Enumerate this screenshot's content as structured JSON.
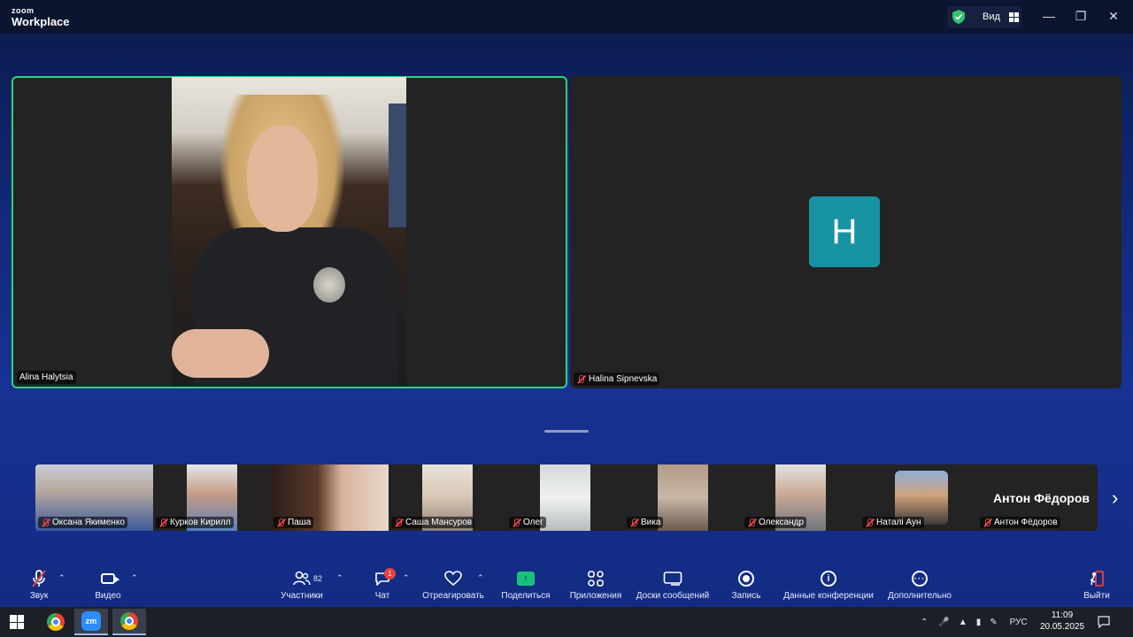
{
  "app": {
    "brand_top": "zoom",
    "brand_bottom": "Workplace",
    "view_label": "Вид",
    "window_controls": [
      "minimize-icon",
      "restore-icon",
      "close-icon"
    ]
  },
  "main_tiles": [
    {
      "name": "Alina Halytsia",
      "muted": false,
      "active": true
    },
    {
      "name": "Halina Sipnevska",
      "muted": true,
      "avatar_letter": "H",
      "avatar_color": "#1793a4"
    }
  ],
  "thumbnails": [
    {
      "name": "Оксана Якименко"
    },
    {
      "name": "Курков Кирилл"
    },
    {
      "name": "Паша"
    },
    {
      "name": "Саша Мансуров"
    },
    {
      "name": "Олег"
    },
    {
      "name": "Вика"
    },
    {
      "name": "Олександр"
    },
    {
      "name": "Наталі Аун"
    },
    {
      "name": "Антон Фёдоров",
      "big_label": "Антон Фёдоров"
    }
  ],
  "toolbar": {
    "audio": "Звук",
    "video": "Видео",
    "participants": "Участники",
    "participants_count": "82",
    "chat": "Чат",
    "chat_badge": "1",
    "react": "Отреагировать",
    "share": "Поделиться",
    "apps": "Приложения",
    "whiteboards": "Доски сообщений",
    "record": "Запись",
    "meeting_info": "Данные конференции",
    "more": "Дополнительно",
    "leave": "Выйти"
  },
  "taskbar": {
    "language": "РУС",
    "time": "11:09",
    "date": "20.05.2025"
  },
  "colors": {
    "active_speaker_border": "#2fd17e",
    "share_green": "#19c07a",
    "muted_red": "#e84545",
    "leave_red": "#e8423b"
  }
}
